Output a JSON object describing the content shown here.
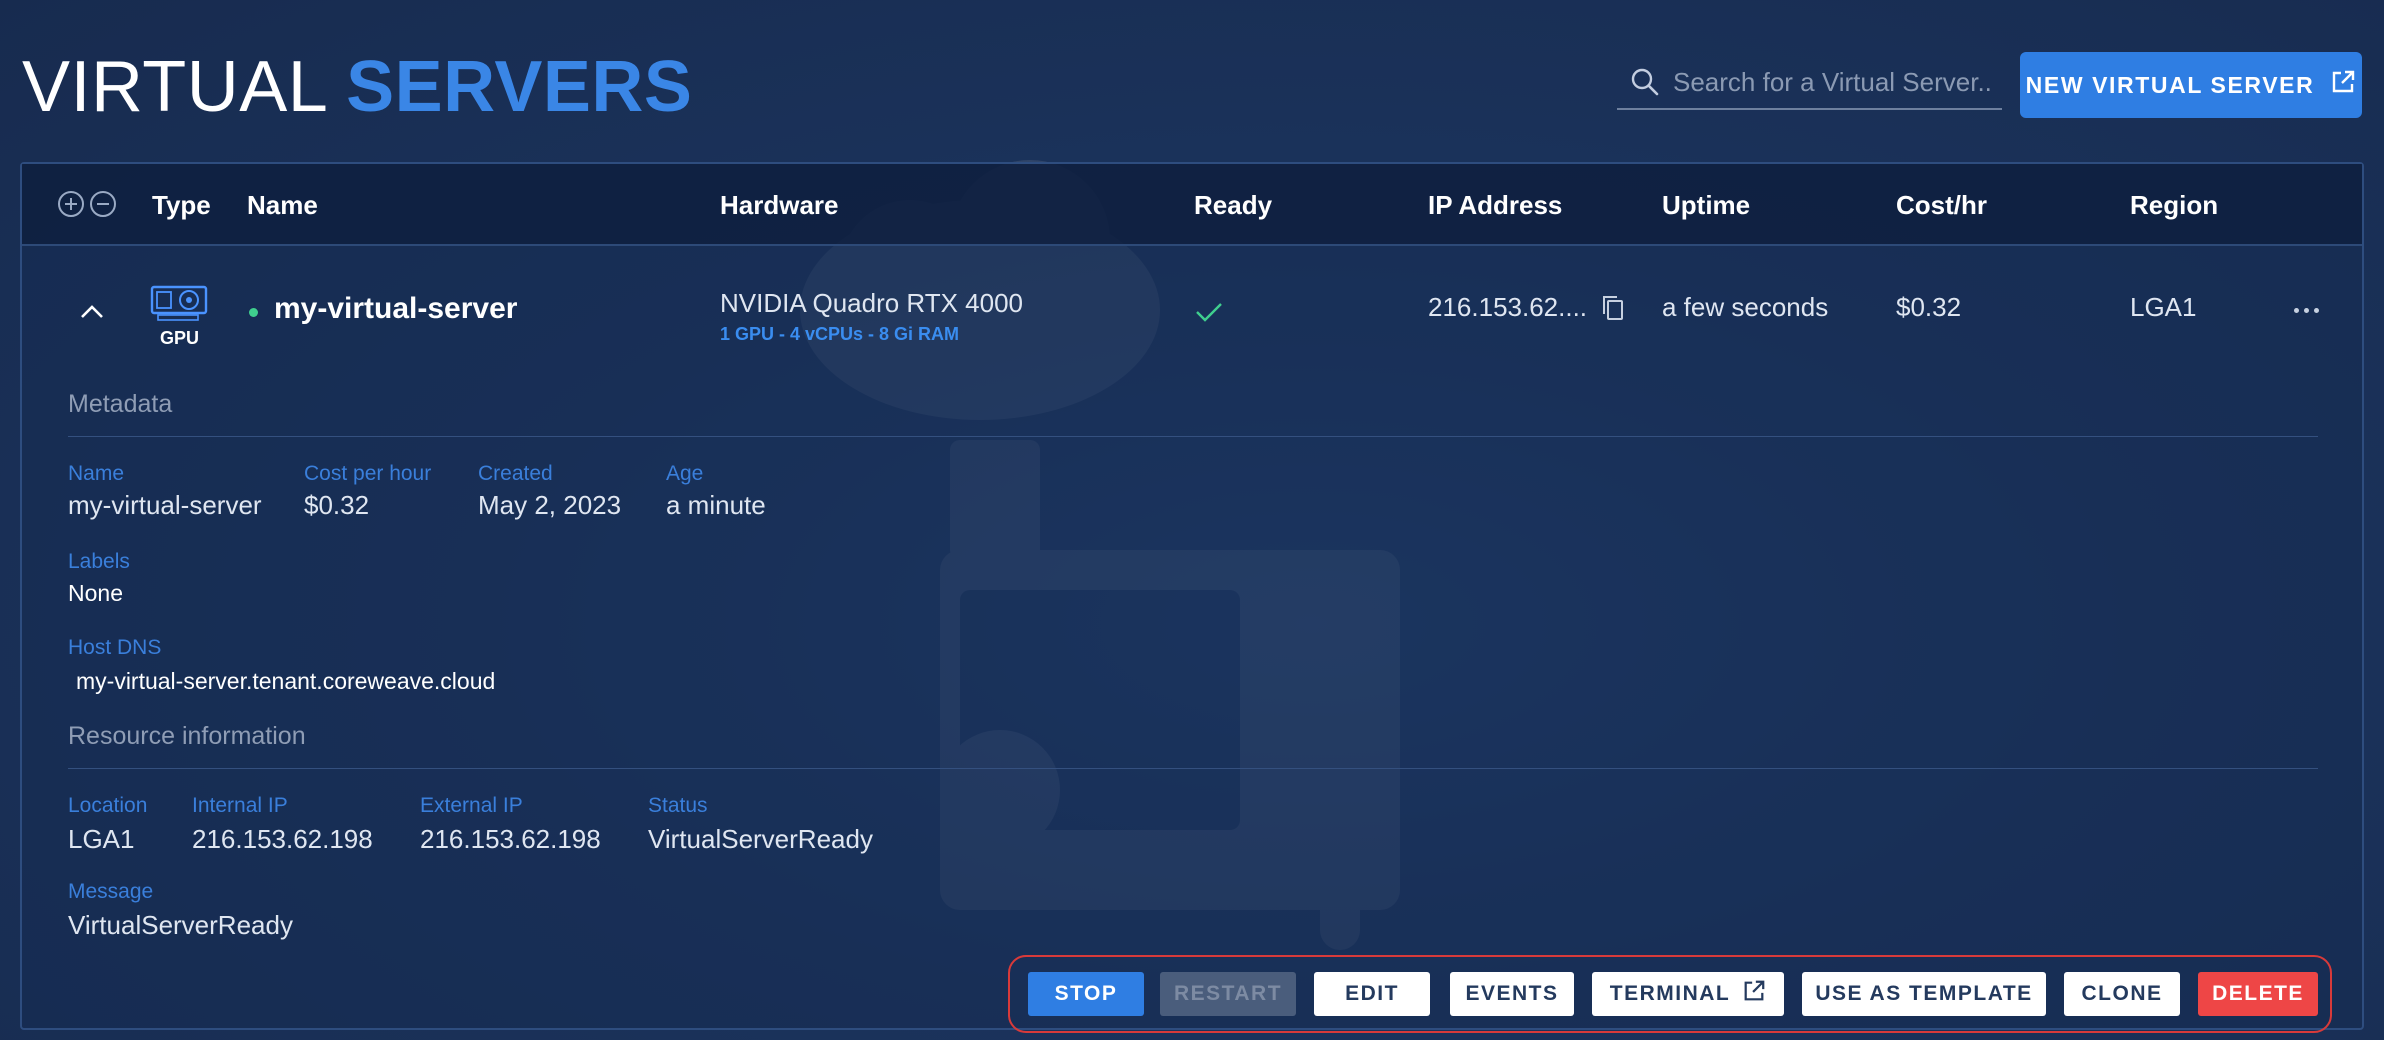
{
  "header": {
    "title_light": "VIRTUAL",
    "title_bold": "SERVERS",
    "search_placeholder": "Search for a Virtual Server...",
    "new_button_label": "NEW VIRTUAL SERVER"
  },
  "table": {
    "columns": {
      "type": "Type",
      "name": "Name",
      "hardware": "Hardware",
      "ready": "Ready",
      "ip": "IP Address",
      "uptime": "Uptime",
      "cost": "Cost/hr",
      "region": "Region"
    },
    "rows": [
      {
        "type_label": "GPU",
        "type_icon": "gpu-card-icon",
        "status_color": "#3fcf8e",
        "name": "my-virtual-server",
        "hardware": "NVIDIA Quadro RTX 4000",
        "hardware_detail": "1 GPU - 4 vCPUs - 8 Gi RAM",
        "ready": true,
        "ip": "216.153.62....",
        "uptime": "a few seconds",
        "cost": "$0.32",
        "region": "LGA1"
      }
    ]
  },
  "details": {
    "metadata_title": "Metadata",
    "name_label": "Name",
    "name_value": "my-virtual-server",
    "cost_label": "Cost per hour",
    "cost_value": "$0.32",
    "created_label": "Created",
    "created_value": "May 2, 2023",
    "age_label": "Age",
    "age_value": "a minute",
    "labels_label": "Labels",
    "labels_value": "None",
    "host_dns_label": "Host DNS",
    "host_dns_value": "my-virtual-server.tenant.coreweave.cloud",
    "resource_title": "Resource information",
    "location_label": "Location",
    "location_value": "LGA1",
    "internal_ip_label": "Internal IP",
    "internal_ip_value": "216.153.62.198",
    "external_ip_label": "External IP",
    "external_ip_value": "216.153.62.198",
    "status_label": "Status",
    "status_value": "VirtualServerReady",
    "message_label": "Message",
    "message_value": "VirtualServerReady"
  },
  "actions": {
    "stop": "STOP",
    "restart": "RESTART",
    "edit": "EDIT",
    "events": "EVENTS",
    "terminal": "TERMINAL",
    "use_as_template": "USE AS TEMPLATE",
    "clone": "CLONE",
    "delete": "DELETE"
  },
  "colors": {
    "accent": "#2f7ee3",
    "danger": "#ee4646",
    "highlight_outline": "#d83a3a",
    "status_ok": "#3fcf8e"
  }
}
